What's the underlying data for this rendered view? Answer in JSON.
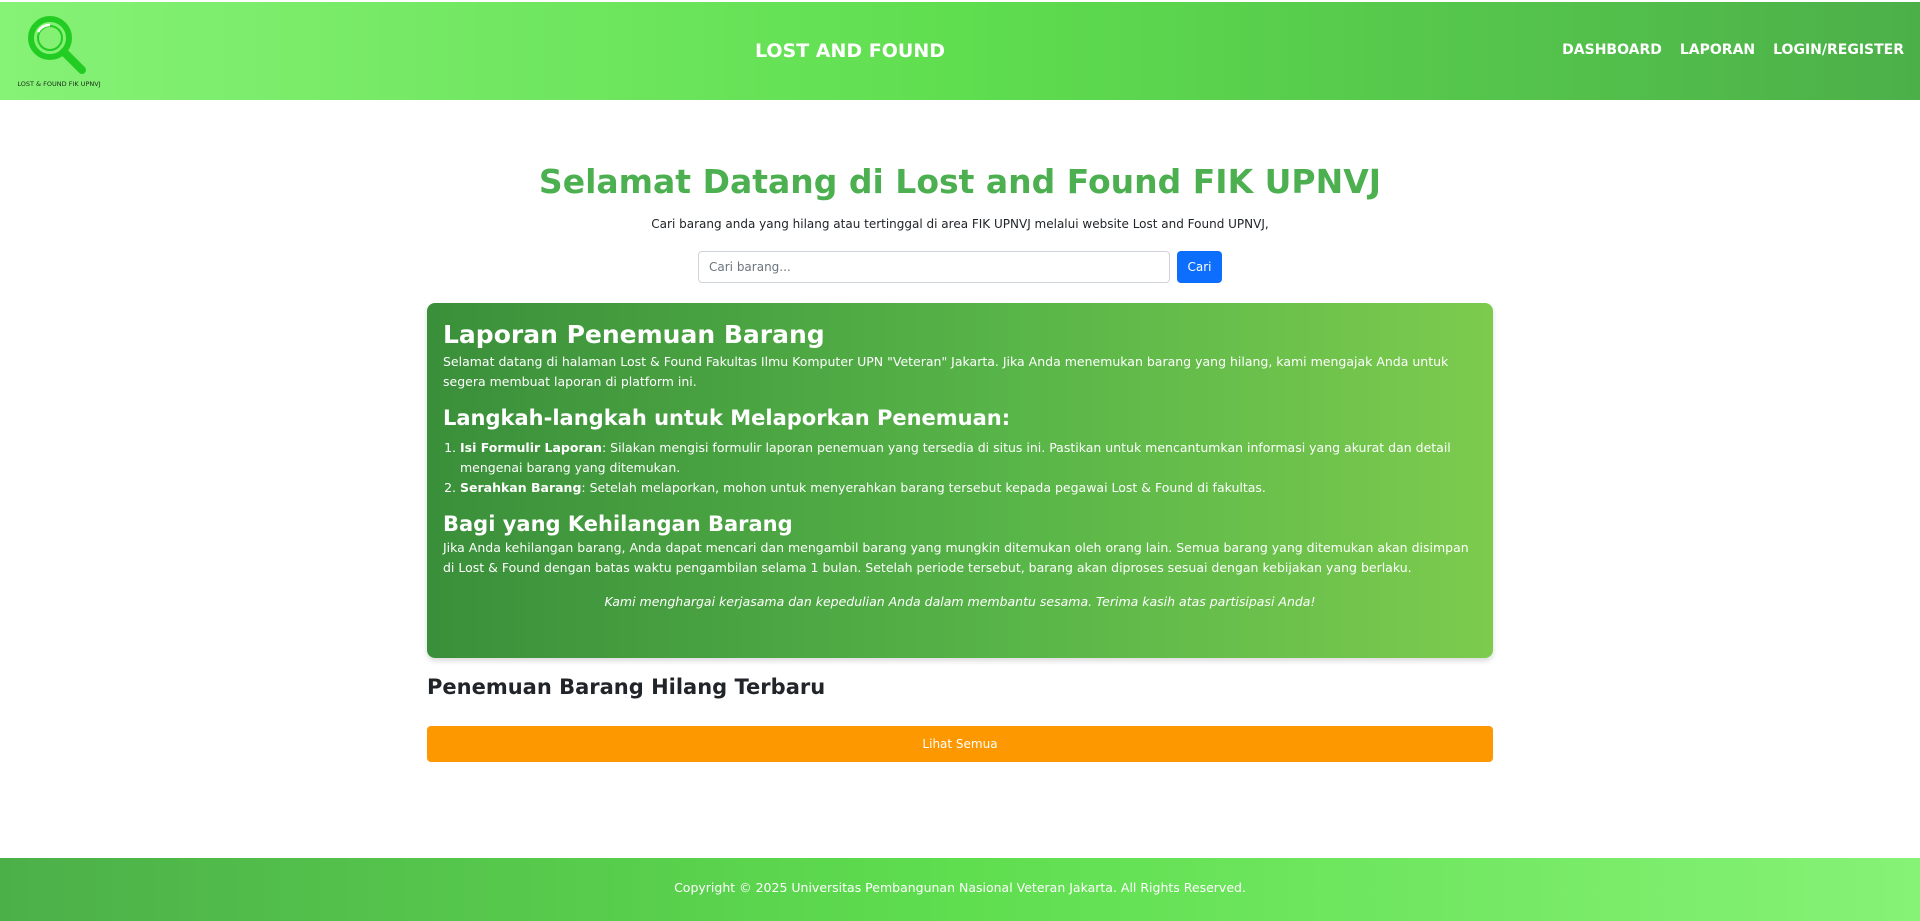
{
  "header": {
    "logo_text": "LOST & FOUND FIK UPNVJ",
    "brand": "LOST AND FOUND",
    "nav": [
      "DASHBOARD",
      "LAPORAN",
      "LOGIN/REGISTER"
    ]
  },
  "hero": {
    "title": "Selamat Datang di Lost and Found FIK UPNVJ",
    "subtitle": "Cari barang anda yang hilang atau tertinggal di area FIK UPNVJ melalui website Lost and Found UPNVJ,"
  },
  "search": {
    "placeholder": "Cari barang...",
    "button": "Cari"
  },
  "info": {
    "title": "Laporan Penemuan Barang",
    "intro": "Selamat datang di halaman Lost & Found Fakultas Ilmu Komputer UPN \"Veteran\" Jakarta. Jika Anda menemukan barang yang hilang, kami mengajak Anda untuk segera membuat laporan di platform ini.",
    "steps_title": "Langkah-langkah untuk Melaporkan Penemuan:",
    "steps": [
      {
        "label": "Isi Formulir Laporan",
        "text": ": Silakan mengisi formulir laporan penemuan yang tersedia di situs ini. Pastikan untuk mencantumkan informasi yang akurat dan detail mengenai barang yang ditemukan."
      },
      {
        "label": "Serahkan Barang",
        "text": ": Setelah melaporkan, mohon untuk menyerahkan barang tersebut kepada pegawai Lost & Found di fakultas."
      }
    ],
    "lost_title": "Bagi yang Kehilangan Barang",
    "lost_text": "Jika Anda kehilangan barang, Anda dapat mencari dan mengambil barang yang mungkin ditemukan oleh orang lain. Semua barang yang ditemukan akan disimpan di Lost & Found dengan batas waktu pengambilan selama 1 bulan. Setelah periode tersebut, barang akan diproses sesuai dengan kebijakan yang berlaku.",
    "thanks": "Kami menghargai kerjasama dan kepedulian Anda dalam membantu sesama. Terima kasih atas partisipasi Anda!"
  },
  "recent": {
    "title": "Penemuan Barang Hilang Terbaru",
    "see_all": "Lihat Semua"
  },
  "footer": {
    "text": "Copyright © 2025 Universitas Pembangunan Nasional Veteran Jakarta. All Rights Reserved."
  },
  "colors": {
    "accent_green": "#4caf50",
    "search_button": "#0d6efd",
    "see_all_button": "#fd9800"
  },
  "icons": {
    "logo": "magnifier-icon"
  }
}
